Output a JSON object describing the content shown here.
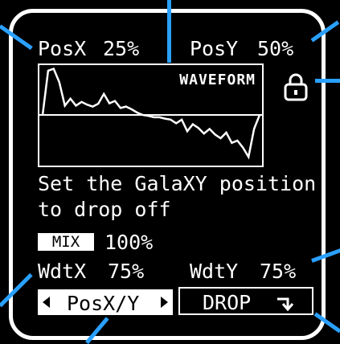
{
  "header": {
    "posx_label": "PosX",
    "posx_value": "25%",
    "posy_label": "PosY",
    "posy_value": "50%"
  },
  "waveform": {
    "label": "WAVEFORM",
    "samples": [
      0.0,
      0.95,
      0.99,
      0.7,
      0.2,
      0.35,
      0.2,
      0.28,
      0.22,
      0.18,
      0.24,
      0.45,
      0.25,
      0.3,
      0.15,
      0.18,
      0.12,
      0.05,
      0.0,
      -0.02,
      -0.05,
      -0.05,
      -0.08,
      -0.1,
      -0.18,
      -0.1,
      -0.35,
      -0.2,
      -0.28,
      -0.4,
      -0.3,
      -0.42,
      -0.5,
      -0.38,
      -0.6,
      -0.55,
      -0.7,
      -0.9,
      -0.3,
      0.0
    ]
  },
  "lock": {
    "icon": "lock-icon"
  },
  "message": {
    "line1": "Set the GalaXY position",
    "line2": "to drop off"
  },
  "mix": {
    "label": "MIX",
    "value": "100%"
  },
  "width": {
    "x_label": "WdtX",
    "x_value": "75%",
    "y_label": "WdtY",
    "y_value": "75%"
  },
  "mode_selector": {
    "label": "PosX/Y"
  },
  "drop_button": {
    "label": "DROP",
    "icon": "drop-arrow-icon"
  },
  "colors": {
    "foreground": "#ffffff",
    "background": "#000000",
    "pointer": "#2aa0ff"
  }
}
